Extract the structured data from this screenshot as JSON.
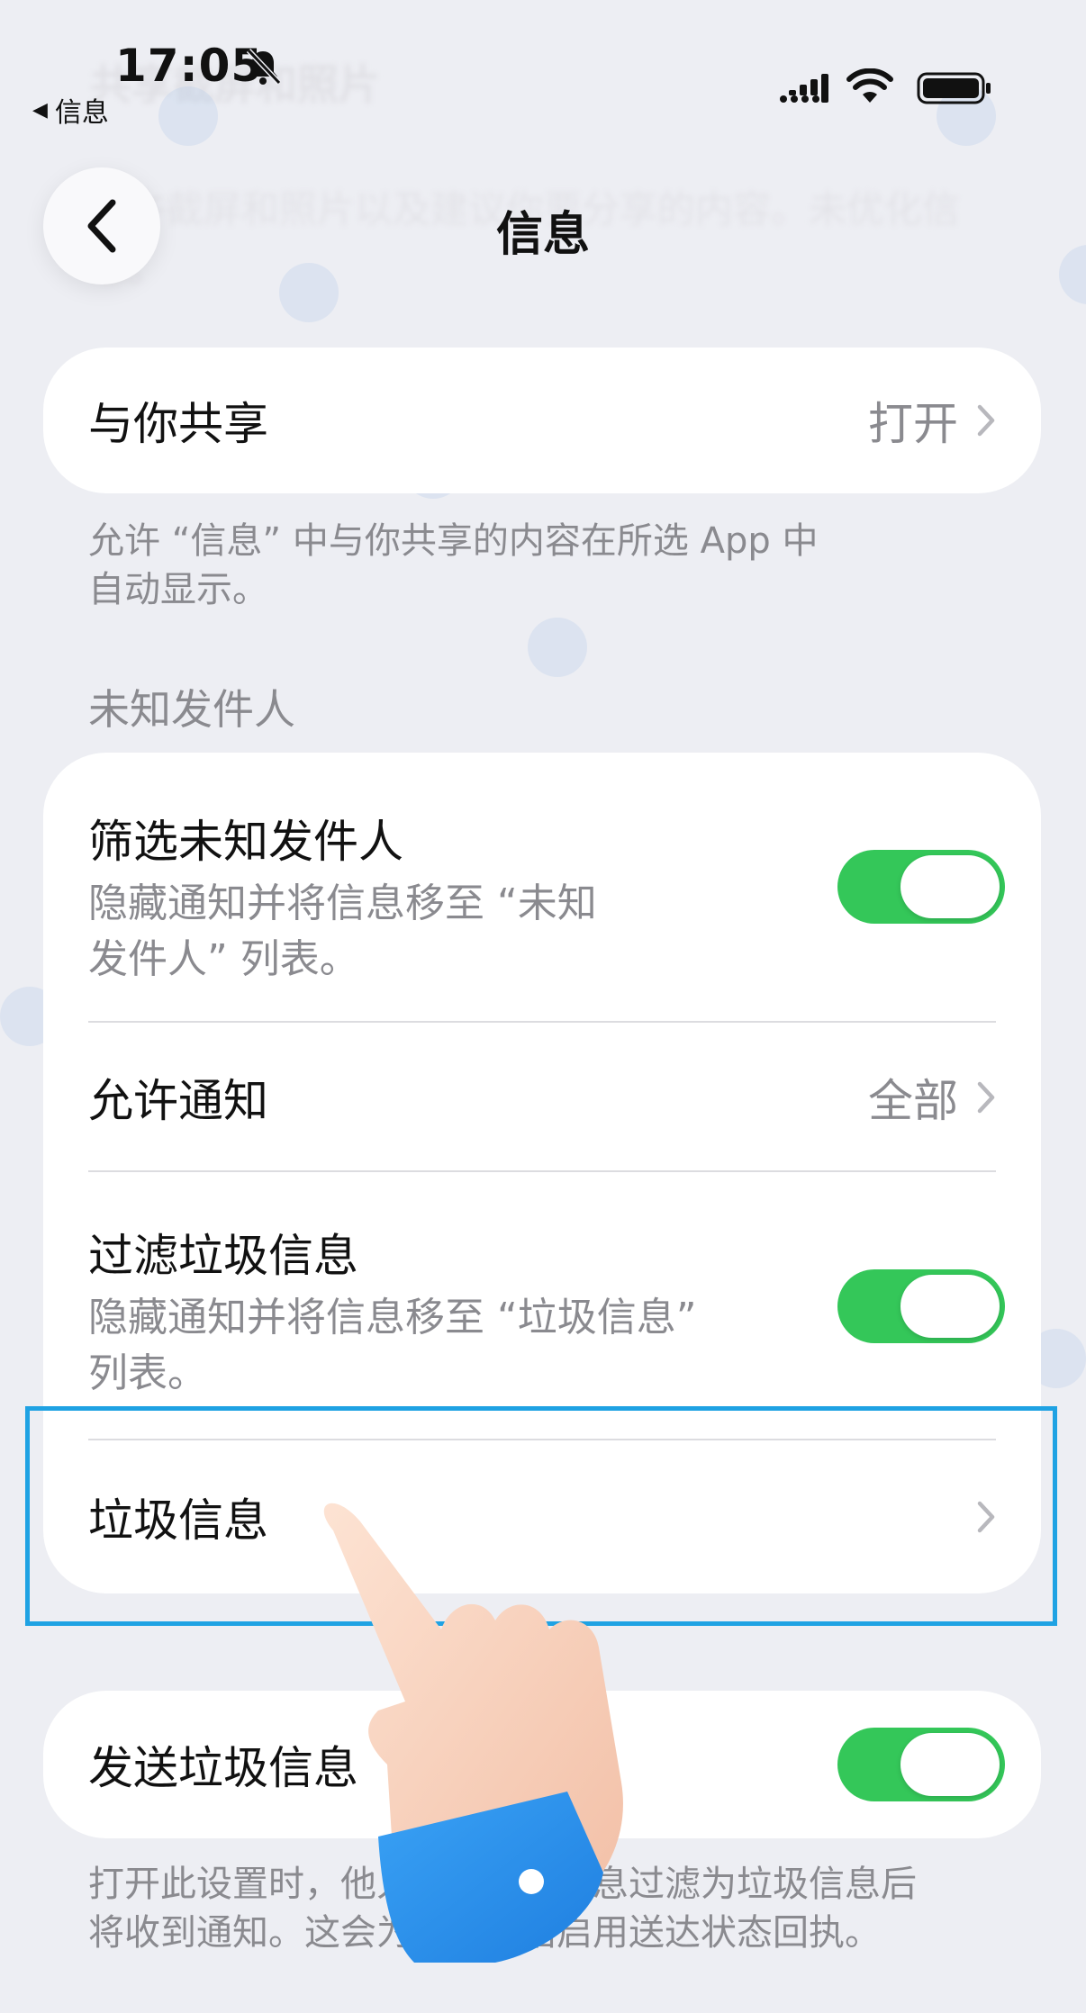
{
  "status_bar": {
    "time": "17:05",
    "back_to_app": "信息"
  },
  "background": {
    "ghost_title": "共享截屏和照片",
    "ghost_text": "允许截屏和照片以及建议你要分享的内容。未优化信息。"
  },
  "nav": {
    "title": "信息"
  },
  "shared_with_you": {
    "label": "与你共享",
    "value": "打开",
    "footnote": "允许 “信息” 中与你共享的内容在所选 App 中\n自动显示。"
  },
  "unknown_senders": {
    "header": "未知发件人",
    "filter": {
      "label": "筛选未知发件人",
      "subtitle": "隐藏通知并将信息移至 “未知\n发件人” 列表。",
      "on": true
    },
    "allow_notifications": {
      "label": "允许通知",
      "value": "全部"
    },
    "filter_junk": {
      "label": "过滤垃圾信息",
      "subtitle": "隐藏通知并将信息移至 “垃圾信息”\n列表。",
      "on": true
    },
    "junk": {
      "label": "垃圾信息"
    }
  },
  "send_junk": {
    "label": "发送垃圾信息",
    "on": true,
    "footnote": "打开此设置时，他人在将你的信息过滤为垃圾信息后\n将收到通知。这会为所有对话启用送达状态回执。"
  },
  "colors": {
    "accent_green": "#34c759",
    "highlight_blue": "#1fa2e3",
    "background": "#edeef3"
  }
}
